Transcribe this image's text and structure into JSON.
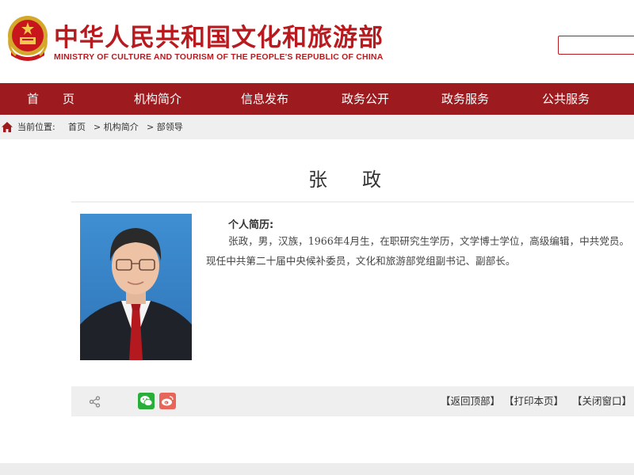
{
  "header": {
    "title": "中华人民共和国文化和旅游部",
    "subtitle": "MINISTRY OF CULTURE AND TOURISM OF THE PEOPLE'S REPUBLIC OF CHINA",
    "search_placeholder": "",
    "brand_color": "#b81b1f"
  },
  "nav": {
    "items": [
      {
        "label": "首　　页"
      },
      {
        "label": "机构简介"
      },
      {
        "label": "信息发布"
      },
      {
        "label": "政务公开"
      },
      {
        "label": "政务服务"
      },
      {
        "label": "公共服务"
      }
    ],
    "bg_color": "#9d1b1e"
  },
  "breadcrumb": {
    "prefix": "当前位置:",
    "items": [
      "首页",
      "> 机构简介",
      "> 部领导"
    ]
  },
  "profile": {
    "name": "张　政",
    "bio_heading": "个人简历:",
    "bio_text": "张政，男，汉族，1966年4月生，在职研究生学历，文学博士学位，高级编辑，中共党员。现任中共第二十届中央候补委员，文化和旅游部党组副书记、副部长。"
  },
  "actions": {
    "back_to_top": "【返回顶部】",
    "print": "【打印本页】",
    "close": "【关闭窗口】"
  }
}
